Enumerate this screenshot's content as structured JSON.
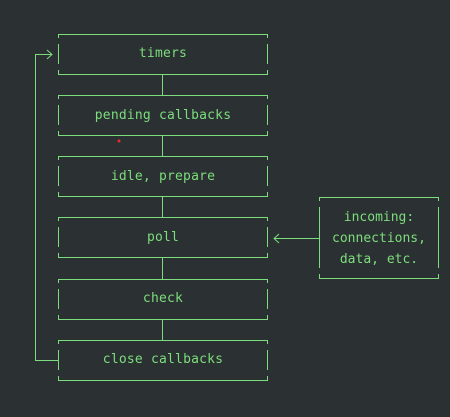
{
  "phases": [
    {
      "label": "timers"
    },
    {
      "label": "pending callbacks"
    },
    {
      "label": "idle, prepare"
    },
    {
      "label": "poll"
    },
    {
      "label": "check"
    },
    {
      "label": "close callbacks"
    }
  ],
  "incoming": {
    "lines": [
      "incoming:",
      "connections,",
      "data, etc."
    ]
  },
  "colors": {
    "background": "#2b3033",
    "line": "#7cdd7c",
    "accent_dot": "#e03030"
  }
}
